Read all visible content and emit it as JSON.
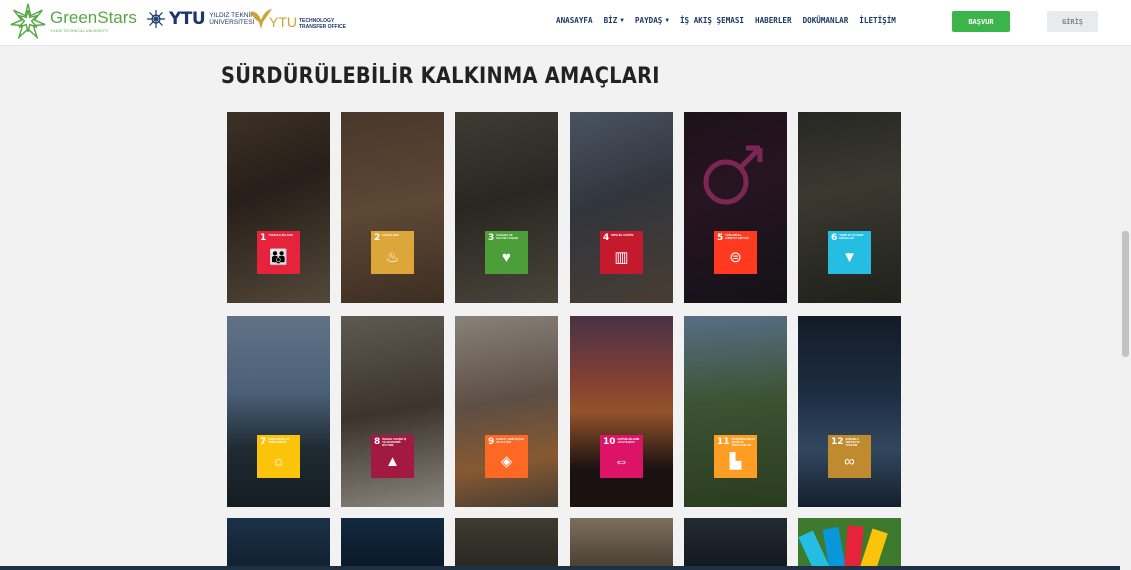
{
  "brand": {
    "greenstars_name": "GreenStars",
    "greenstars_sub": "YILDIZ TECHNICAL UNIVERSITY",
    "ytu_mark": "YTU",
    "ytu_line1": "YILDIZ TEKNİK",
    "ytu_line2": "ÜNİVERSİTESİ",
    "tto_mark": "YTU",
    "tto_line1": "TECHNOLOGY",
    "tto_line2": "TRANSFER OFFICE"
  },
  "nav": {
    "items": [
      {
        "label": "ANASAYFA",
        "has_dropdown": false
      },
      {
        "label": "BİZ",
        "has_dropdown": true
      },
      {
        "label": "PAYDAŞ",
        "has_dropdown": true
      },
      {
        "label": "İŞ AKIŞ ŞEMASI",
        "has_dropdown": false
      },
      {
        "label": "HABERLER",
        "has_dropdown": false
      },
      {
        "label": "DOKÜMANLAR",
        "has_dropdown": false
      },
      {
        "label": "İLETİŞİM",
        "has_dropdown": false
      }
    ],
    "caret": "▼"
  },
  "buttons": {
    "apply": "BAŞVUR",
    "login": "GİRİŞ"
  },
  "page_title": "SÜRDÜRÜLEBİLİR KALKINMA AMAÇLARI",
  "goals": [
    {
      "number": "1",
      "label": "YOKSULLUĞA SON",
      "color": "#e5243b",
      "icon": "family-icon",
      "glyph": "👪"
    },
    {
      "number": "2",
      "label": "AÇLIĞA SON",
      "color": "#dda63a",
      "icon": "bowl-icon",
      "glyph": "♨"
    },
    {
      "number": "3",
      "label": "SAĞLIKLI VE KALİTELİ YAŞAM",
      "color": "#4c9f38",
      "icon": "heartbeat-icon",
      "glyph": "♥"
    },
    {
      "number": "4",
      "label": "NİTELİKLİ EĞİTİM",
      "color": "#c5192d",
      "icon": "book-icon",
      "glyph": "▥"
    },
    {
      "number": "5",
      "label": "TOPLUMSAL CİNSİYET EŞİTLİĞİ",
      "color": "#ff3a21",
      "icon": "gender-equality-icon",
      "glyph": "⊜"
    },
    {
      "number": "6",
      "label": "TEMİZ SU VE SIHHİ KOŞULLAR",
      "color": "#26bde2",
      "icon": "water-icon",
      "glyph": "▼"
    },
    {
      "number": "7",
      "label": "ERİŞİLEBİLİR VE TEMİZ ENERJİ",
      "color": "#fcc30b",
      "icon": "sun-icon",
      "glyph": "☼"
    },
    {
      "number": "8",
      "label": "İNSANA YAKIŞIR İŞ VE EKONOMİK BÜYÜME",
      "color": "#a21942",
      "icon": "growth-chart-icon",
      "glyph": "▲"
    },
    {
      "number": "9",
      "label": "SANAYİ, YENİLİKÇİLİK VE ALTYAPI",
      "color": "#fd6925",
      "icon": "cubes-icon",
      "glyph": "◈"
    },
    {
      "number": "10",
      "label": "EŞİTSİZLİKLERİN AZALTILMASI",
      "color": "#dd1367",
      "icon": "equality-arrows-icon",
      "glyph": "⇔"
    },
    {
      "number": "11",
      "label": "SÜRDÜRÜLEBİLİR ŞEHİR VE TOPLULUKLAR",
      "color": "#fd9d24",
      "icon": "city-icon",
      "glyph": "▙"
    },
    {
      "number": "12",
      "label": "SORUMLU ÜRETİM VE TÜKETİM",
      "color": "#bf8b2e",
      "icon": "infinity-icon",
      "glyph": "∞"
    }
  ]
}
